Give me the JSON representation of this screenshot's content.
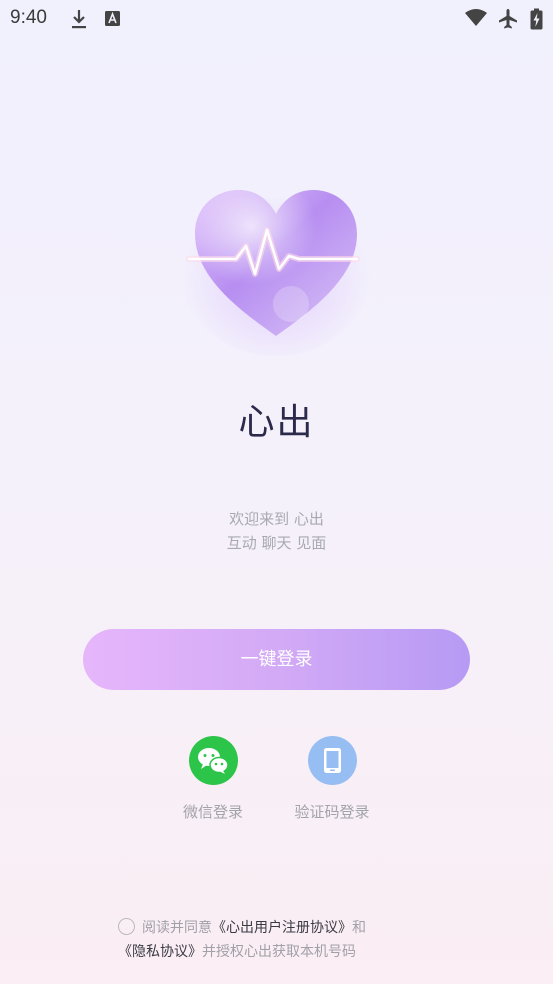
{
  "status_bar": {
    "time": "9:40",
    "left_icons": [
      "download-icon",
      "keyboard-icon"
    ],
    "right_icons": [
      "wifi-icon",
      "airplane-mode-icon",
      "battery-charging-icon"
    ]
  },
  "app": {
    "name": "心出",
    "welcome": "欢迎来到 心出",
    "slogan": "互动 聊天 见面"
  },
  "login": {
    "one_click_label": "一键登录",
    "wechat_label": "微信登录",
    "sms_label": "验证码登录"
  },
  "agreement": {
    "prefix": "阅读并同意",
    "user_agreement": "《心出用户注册协议》",
    "and": "和",
    "privacy_policy": "《隐私协议》",
    "suffix": "并授权心出获取本机号码"
  },
  "colors": {
    "accent_start": "#e6b6fb",
    "accent_end": "#b69af4",
    "wechat_green": "#2dc44a",
    "sms_blue": "#97bef3",
    "title_color": "#2b2a4a"
  }
}
